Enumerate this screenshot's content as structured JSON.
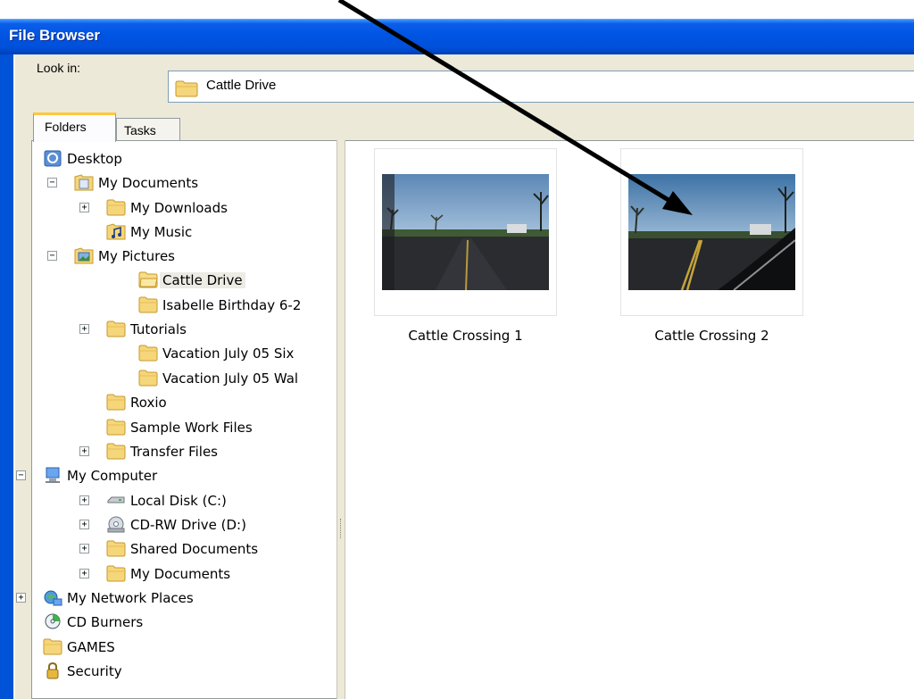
{
  "window": {
    "title": "File Browser"
  },
  "look_in": {
    "label": "Look in:",
    "value": "Cattle Drive"
  },
  "tabs": [
    {
      "label": "Folders",
      "active": true
    },
    {
      "label": "Tasks",
      "active": false
    }
  ],
  "tree": [
    {
      "label": "Desktop",
      "icon": "desktop-icon"
    },
    {
      "label": "My Documents",
      "icon": "my-documents-icon",
      "expander": "minus"
    },
    {
      "label": "My Downloads",
      "icon": "folder-icon",
      "expander": "plus"
    },
    {
      "label": "My Music",
      "icon": "music-folder-icon"
    },
    {
      "label": "My Pictures",
      "icon": "pictures-folder-icon",
      "expander": "minus"
    },
    {
      "label": "Cattle Drive",
      "icon": "folder-open-icon",
      "selected": true
    },
    {
      "label": "Isabelle Birthday 6-2",
      "icon": "folder-icon"
    },
    {
      "label": "Tutorials",
      "icon": "folder-icon",
      "expander": "plus"
    },
    {
      "label": "Vacation July 05 Six",
      "icon": "folder-icon"
    },
    {
      "label": "Vacation July 05 Wal",
      "icon": "folder-icon"
    },
    {
      "label": "Roxio",
      "icon": "folder-icon"
    },
    {
      "label": "Sample Work Files",
      "icon": "folder-icon"
    },
    {
      "label": "Transfer Files",
      "icon": "folder-icon",
      "expander": "plus"
    },
    {
      "label": "My Computer",
      "icon": "computer-icon",
      "expander": "minus"
    },
    {
      "label": "Local Disk (C:)",
      "icon": "hard-disk-icon",
      "expander": "plus"
    },
    {
      "label": "CD-RW Drive (D:)",
      "icon": "cd-drive-icon",
      "expander": "plus"
    },
    {
      "label": "Shared Documents",
      "icon": "folder-icon",
      "expander": "plus"
    },
    {
      "label": "My Documents",
      "icon": "folder-icon",
      "expander": "plus"
    },
    {
      "label": "My Network Places",
      "icon": "network-icon",
      "expander": "plus"
    },
    {
      "label": "CD Burners",
      "icon": "cd-burner-icon"
    },
    {
      "label": "GAMES",
      "icon": "folder-icon"
    },
    {
      "label": "Security",
      "icon": "lock-icon"
    }
  ],
  "thumbnails": [
    {
      "caption": "Cattle Crossing 1"
    },
    {
      "caption": "Cattle Crossing 2"
    }
  ],
  "colors": {
    "titlebar": "#0054e3",
    "frame": "#0052d6",
    "folder": "#f6d67a"
  }
}
